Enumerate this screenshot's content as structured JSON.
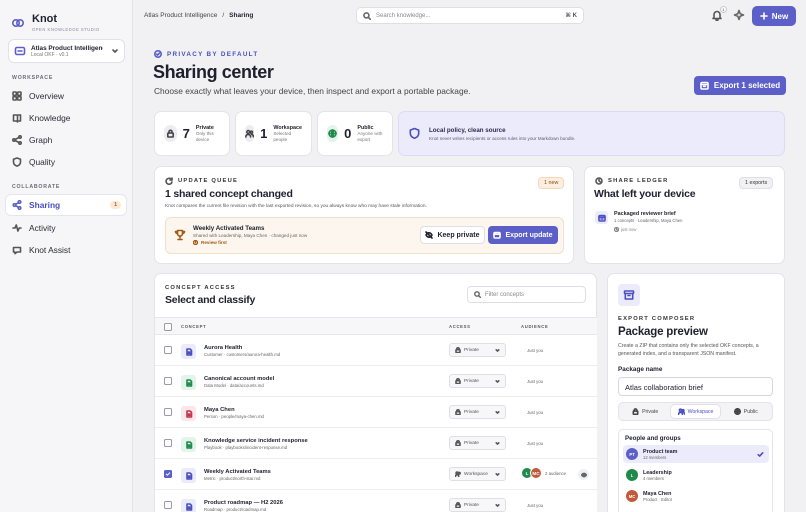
{
  "brand": {
    "name": "Knot",
    "tagline": "OPEN KNOWLEDGE STUDIO"
  },
  "workspace": {
    "name": "Atlas Product Intelligence",
    "meta": "Local OKF · v0.1"
  },
  "sidebar": {
    "workspace_label": "WORKSPACE",
    "collaborate_label": "COLLABORATE",
    "items": [
      {
        "label": "Overview",
        "icon": "overview-icon"
      },
      {
        "label": "Knowledge",
        "icon": "book-icon"
      },
      {
        "label": "Graph",
        "icon": "graph-icon"
      },
      {
        "label": "Quality",
        "icon": "shield-icon"
      }
    ],
    "collab_items": [
      {
        "label": "Sharing",
        "icon": "share-icon",
        "count": "1",
        "active": true
      },
      {
        "label": "Activity",
        "icon": "activity-icon"
      },
      {
        "label": "Knot Assist",
        "icon": "assist-icon"
      }
    ]
  },
  "header": {
    "breadcrumb": {
      "parent": "Atlas Product Intelligence",
      "sep": "/",
      "current": "Sharing"
    },
    "search": {
      "placeholder": "Search knowledge...",
      "shortcut": "⌘ K"
    },
    "notifications_count": "1",
    "new_label": "New"
  },
  "hero": {
    "eyebrow": "PRIVACY BY DEFAULT",
    "title": "Sharing center",
    "subtitle": "Choose exactly what leaves your device, then inspect and export a portable package.",
    "export_label": "Export 1 selected"
  },
  "stats": [
    {
      "value": "7",
      "label": "Private",
      "sub": "Only this device"
    },
    {
      "value": "1",
      "label": "Workspace",
      "sub": "Selected people"
    },
    {
      "value": "0",
      "label": "Public",
      "sub": "Anyone with export"
    }
  ],
  "policy": {
    "title": "Local policy, clean source",
    "sub": "Knot never writes recipients or access rules into your Markdown bundle."
  },
  "queue": {
    "eyebrow": "UPDATE QUEUE",
    "badge": "1 new",
    "title": "1 shared concept changed",
    "note": "Knot compares the current file revision with the last exported revision, so you always know who may have stale information.",
    "item": {
      "title": "Weekly Activated Teams",
      "sub": "Shared with Leadership, Maya Chen · changed just now",
      "review": "Review first"
    },
    "keep_label": "Keep private",
    "export_label": "Export update"
  },
  "ledger": {
    "eyebrow": "SHARE LEDGER",
    "badge": "1 exports",
    "title": "What left your device",
    "entry": {
      "title": "Packaged reviewer brief",
      "sub": "1 concepts · Leadership, Maya Chen",
      "when": "just now"
    }
  },
  "concepts": {
    "eyebrow": "CONCEPT ACCESS",
    "title": "Select and classify",
    "filter_placeholder": "Filter concepts",
    "columns": {
      "concept": "CONCEPT",
      "access": "ACCESS",
      "audience": "AUDIENCE"
    },
    "rows": [
      {
        "name": "Aurora Health",
        "sub": "Customer · customers/aurora-health.md",
        "access": "Private",
        "audience": "Just you",
        "checked": false,
        "icon": "document-icon",
        "tint": "#ecebfb",
        "color": "#4a4fbf"
      },
      {
        "name": "Canonical account model",
        "sub": "Data Model · data/accounts.md",
        "access": "Private",
        "audience": "Just you",
        "checked": false,
        "icon": "document-icon",
        "tint": "#e4f4ea",
        "color": "#1f8a4c"
      },
      {
        "name": "Maya Chen",
        "sub": "Person · people/maya-chen.md",
        "access": "Private",
        "audience": "Just you",
        "checked": false,
        "icon": "document-icon",
        "tint": "#fbe6ea",
        "color": "#c2344f"
      },
      {
        "name": "Knowledge service incident response",
        "sub": "Playbook · playbooks/incident-response.md",
        "access": "Private",
        "audience": "Just you",
        "checked": false,
        "icon": "document-icon",
        "tint": "#e4f4ea",
        "color": "#1f8a4c"
      },
      {
        "name": "Weekly Activated Teams",
        "sub": "Metric · product/north-star.md",
        "access": "Workspace",
        "audience": "2 audience",
        "checked": true,
        "icon": "document-icon",
        "tint": "#ecebfb",
        "color": "#4a4fbf"
      },
      {
        "name": "Product roadmap — H2 2026",
        "sub": "Roadmap · product/roadmap.md",
        "access": "Private",
        "audience": "Just you",
        "checked": false,
        "icon": "document-icon",
        "tint": "#ecebfb",
        "color": "#4a4fbf"
      }
    ],
    "audience_avatars": [
      {
        "initials": "L",
        "color": "#1f8a4c"
      },
      {
        "initials": "MC",
        "color": "#c25a3a"
      }
    ]
  },
  "composer": {
    "eyebrow": "EXPORT COMPOSER",
    "title": "Package preview",
    "desc": "Create a ZIP that contains only the selected OKF concepts, a generated index, and a transparent JSON manifest.",
    "field_label": "Package name",
    "field_value": "Atlas collaboration brief",
    "segments": [
      {
        "label": "Private"
      },
      {
        "label": "Workspace",
        "active": true
      },
      {
        "label": "Public"
      }
    ],
    "people_title": "People and groups",
    "people": [
      {
        "initials": "PT",
        "name": "Product team",
        "sub": "12 members",
        "color": "#5b5fc7",
        "selected": true
      },
      {
        "initials": "L",
        "name": "Leadership",
        "sub": "4 members",
        "color": "#1f8a4c",
        "selected": false
      },
      {
        "initials": "MC",
        "name": "Maya Chen",
        "sub": "Product · Editor",
        "color": "#c25a3a",
        "selected": false
      }
    ]
  }
}
